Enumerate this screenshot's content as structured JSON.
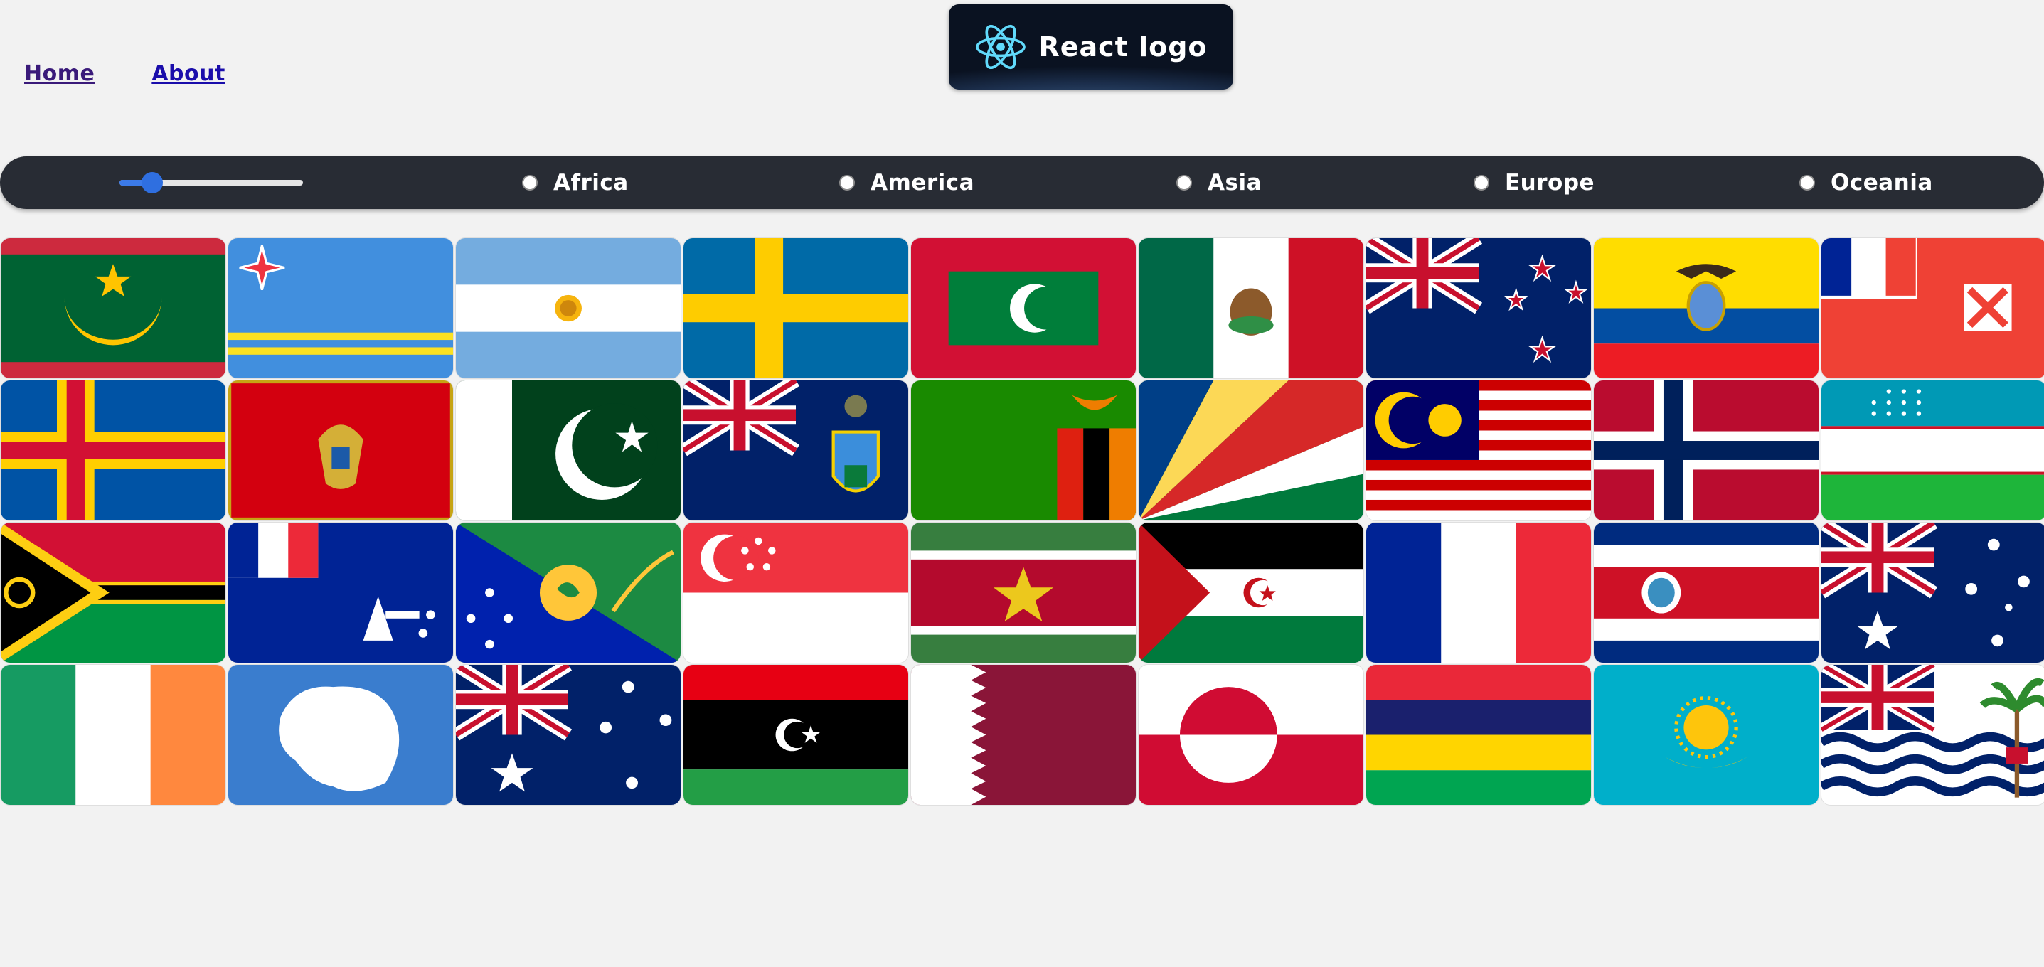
{
  "nav": {
    "home": "Home",
    "about": "About"
  },
  "logo": {
    "text": "React logo",
    "icon": "react-atom-icon"
  },
  "filter": {
    "slider_value_fraction": 0.18,
    "regions": [
      "Africa",
      "America",
      "Asia",
      "Europe",
      "Oceania"
    ]
  },
  "flags": [
    "mauritania-flag",
    "aruba-flag",
    "argentina-flag",
    "sweden-flag",
    "maldives-flag",
    "mexico-flag",
    "new-zealand-flag",
    "ecuador-flag",
    "wallis-and-futuna-flag",
    "aland-islands-flag",
    "montenegro-flag",
    "pakistan-flag",
    "pitcairn-islands-flag",
    "zambia-flag",
    "seychelles-flag",
    "malaysia-flag",
    "norway-flag",
    "uzbekistan-flag",
    "vanuatu-flag",
    "french-southern-territories-flag",
    "christmas-island-flag",
    "singapore-flag",
    "suriname-flag",
    "western-sahara-flag",
    "france-flag",
    "costa-rica-flag",
    "australia-flag",
    "ireland-flag",
    "antarctica-flag",
    "heard-island-flag",
    "libya-flag",
    "qatar-flag",
    "greenland-flag",
    "mauritius-flag",
    "kazakhstan-flag",
    "british-indian-ocean-territory-flag"
  ]
}
